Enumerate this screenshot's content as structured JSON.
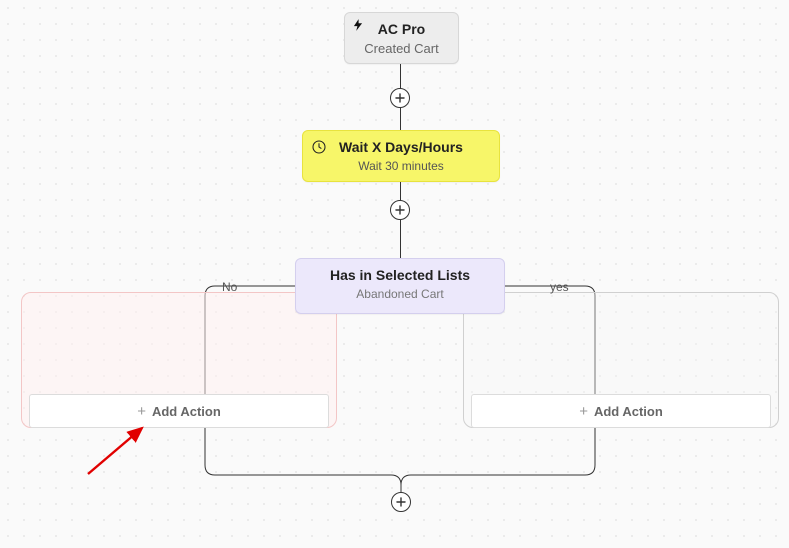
{
  "trigger": {
    "title": "AC Pro",
    "subtitle": "Created Cart"
  },
  "wait": {
    "title": "Wait X Days/Hours",
    "subtitle": "Wait 30 minutes"
  },
  "condition": {
    "title": "Has in Selected Lists",
    "subtitle": "Abandoned Cart"
  },
  "branch": {
    "no_label": "No",
    "yes_label": "yes"
  },
  "buttons": {
    "add_action": "Add Action"
  }
}
